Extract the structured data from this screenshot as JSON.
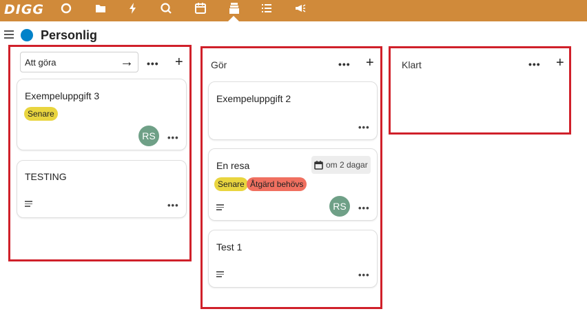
{
  "app": {
    "logo_text": "DIGG",
    "nav": [
      {
        "icon": "dashboard-icon"
      },
      {
        "icon": "files-icon"
      },
      {
        "icon": "activity-icon"
      },
      {
        "icon": "search-icon"
      },
      {
        "icon": "calendar-icon"
      },
      {
        "icon": "deck-icon",
        "active": true
      },
      {
        "icon": "tasks-icon"
      },
      {
        "icon": "announcements-icon"
      }
    ],
    "accent_color": "#d08a3a"
  },
  "board": {
    "title": "Personlig",
    "color": "#0082c9"
  },
  "stacks": [
    {
      "title": "Att göra",
      "editing": true,
      "cards": [
        {
          "title": "Exempeluppgift 3",
          "labels": [
            {
              "text": "Senare",
              "color": "#e9d53f"
            }
          ],
          "avatar": "RS"
        },
        {
          "title": "TESTING",
          "has_description": true
        }
      ]
    },
    {
      "title": "Gör",
      "cards": [
        {
          "title": "Exempeluppgift 2"
        },
        {
          "title": "En resa",
          "due": "om 2 dagar",
          "labels": [
            {
              "text": "Senare",
              "color": "#e9d53f"
            },
            {
              "text": "Åtgärd behövs",
              "color": "#f07060"
            }
          ],
          "avatar": "RS",
          "has_description": true
        },
        {
          "title": "Test 1",
          "has_description": true
        }
      ]
    },
    {
      "title": "Klart",
      "cards": []
    }
  ],
  "actions": {
    "more": "•••",
    "add": "+",
    "submit_arrow": "→"
  }
}
